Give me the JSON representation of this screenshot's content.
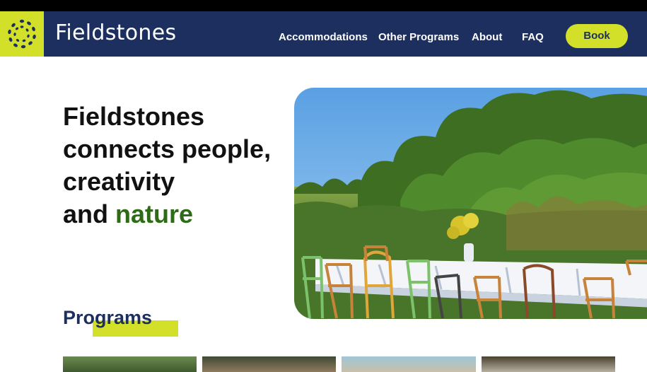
{
  "brand": {
    "name": "Fieldstones",
    "logo_icon": "circle-dots-logo-icon",
    "accent": "#d3e02a",
    "navy": "#1c2f5e",
    "green": "#2e6b16"
  },
  "nav": {
    "links": [
      "Accommodations",
      "Other Programs",
      "About",
      "FAQ"
    ],
    "book_label": "Book"
  },
  "hero": {
    "line1": "Fieldstones",
    "line2": "connects people,",
    "line3": "creativity",
    "line4_prefix": "and ",
    "line4_highlight": "nature",
    "image_alt": "Outdoor dining tables with mismatched chairs in a green field"
  },
  "programs": {
    "title": "Programs"
  }
}
